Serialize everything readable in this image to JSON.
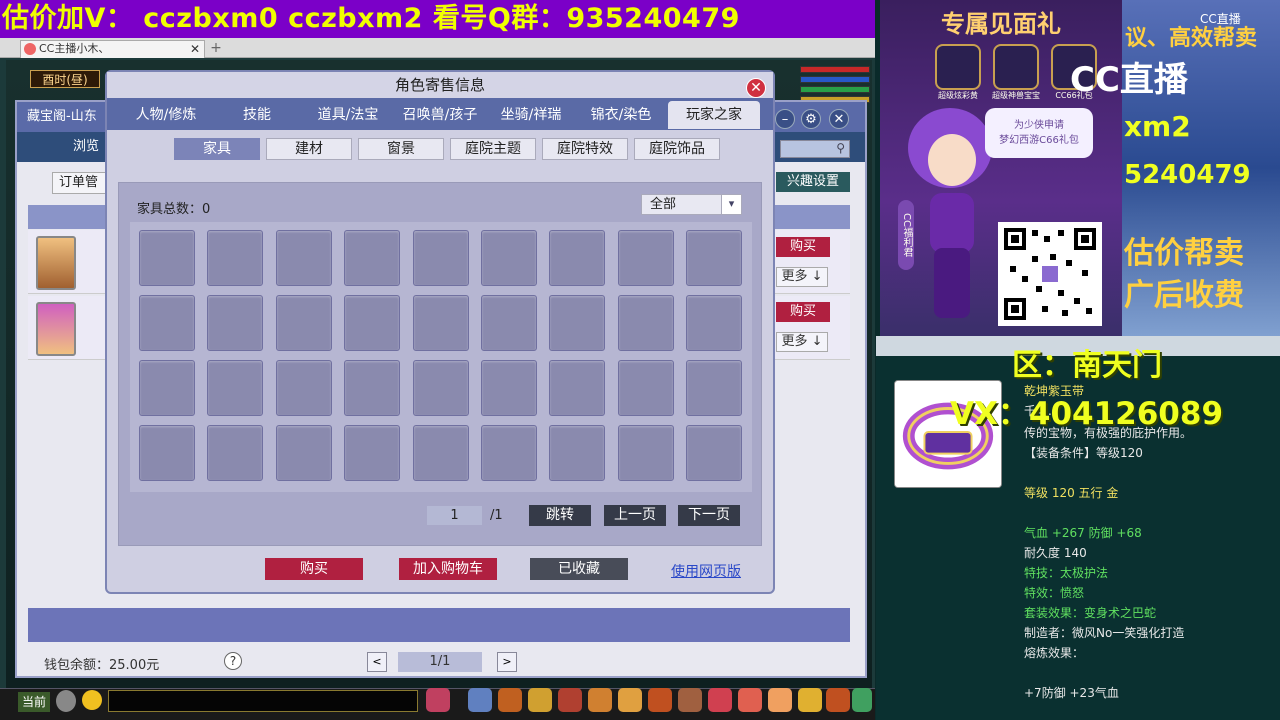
{
  "banner": {
    "text": "估价加V：  cczbxm0   cczbxm2   看号Q群：935240479"
  },
  "browser": {
    "tab_title": "CC主播小木、",
    "tab_close": "✕",
    "new_tab": "+"
  },
  "game": {
    "time_label": "酉时(昼)",
    "chat_channel": "当前"
  },
  "shop": {
    "title": "藏宝阁-山东",
    "subnav": "浏览",
    "order_mgr": "订单管",
    "interest_settings": "兴趣设置",
    "rows": [
      {
        "buy": "购买",
        "more": "更多 ↓"
      },
      {
        "buy": "购买",
        "more": "更多 ↓"
      }
    ],
    "wallet": "钱包余额：25.00元",
    "help": "?",
    "page": "1/1",
    "prev": "<",
    "next": ">"
  },
  "dialog": {
    "title": "角色寄售信息",
    "close": "✕",
    "tabs": [
      "人物/修炼",
      "技能",
      "道具/法宝",
      "召唤兽/孩子",
      "坐骑/祥瑞",
      "锦衣/染色",
      "玩家之家"
    ],
    "active_tab": "玩家之家",
    "subtabs": [
      "家具",
      "建材",
      "窗景",
      "庭院主题",
      "庭院特效",
      "庭院饰品"
    ],
    "active_subtab": "家具",
    "count_label": "家具总数：",
    "count_value": "0",
    "filter": "全部",
    "filter_arrow": "▾",
    "page_current": "1",
    "page_total": "/1",
    "jump": "跳转",
    "prev_page": "上一页",
    "next_page": "下一页",
    "buy": "购买",
    "add_cart": "加入购物车",
    "favorited": "已收藏",
    "web_version": "使用网页版"
  },
  "stream": {
    "ad_title": "专属见面礼",
    "gift_labels": [
      "超级炫彩黄",
      "超级神兽宝宝",
      "CC66礼包"
    ],
    "speech": "为少侠申请\n梦幻西游C66礼包",
    "side_label": "CC福利君",
    "cc_logo": "CC直播",
    "cc_logo_small": "CC直播",
    "right_texts": [
      "议、高效帮卖",
      "xm2",
      "5240479",
      "估价帮卖",
      "广后收费"
    ],
    "region": "区：南天门",
    "vx": "VX：404126089",
    "item_lines": [
      {
        "text": "乾坤紫玉带",
        "style": "y"
      },
      {
        "text": "千年...",
        "style": ""
      },
      {
        "text": "传的宝物，有极强的庇护作用。",
        "style": ""
      },
      {
        "text": "【装备条件】等级120",
        "style": ""
      },
      {
        "text": "等级 120 五行 金",
        "style": "y"
      },
      {
        "text": "气血 +267 防御 +68",
        "style": "g"
      },
      {
        "text": "耐久度 140",
        "style": ""
      },
      {
        "text": "特技：太极护法",
        "style": "g"
      },
      {
        "text": "特效：愤怒",
        "style": "g"
      },
      {
        "text": "套装效果：变身术之巴蛇",
        "style": "g"
      },
      {
        "text": "制造者：微风No一笑强化打造",
        "style": ""
      },
      {
        "text": "熔炼效果：",
        "style": ""
      },
      {
        "text": "+7防御 +23气血",
        "style": ""
      }
    ]
  },
  "colors": {
    "banner_bg": "#7b00c8",
    "banner_text": "#f0ff00",
    "buy_red": "#b02040",
    "dark_btn": "#353a48",
    "link_blue": "#2a48c8"
  }
}
